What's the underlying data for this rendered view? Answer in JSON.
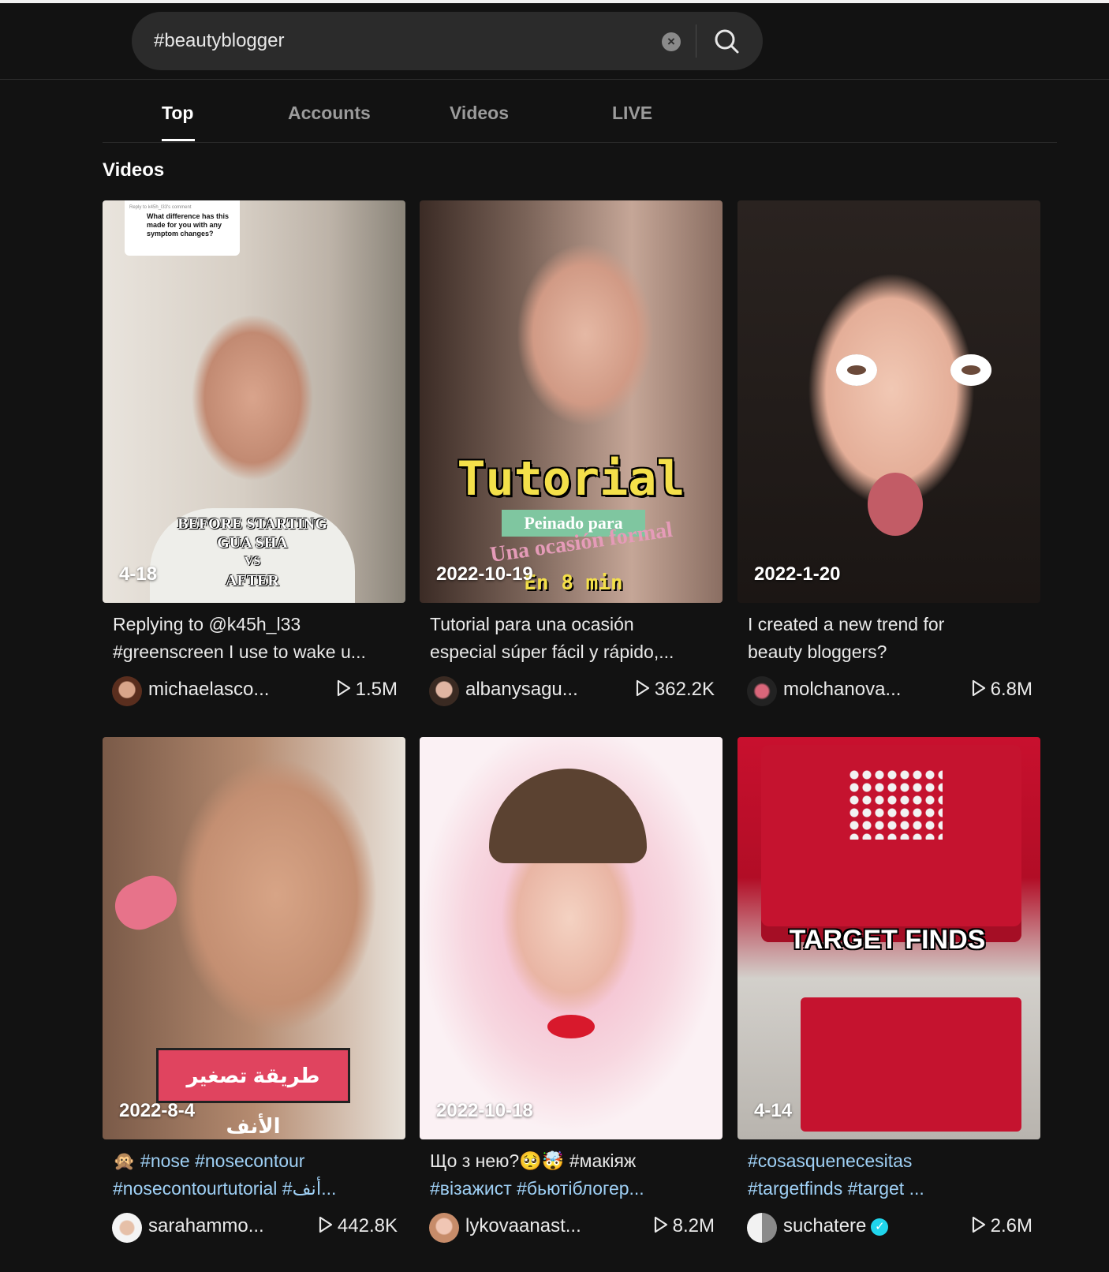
{
  "search": {
    "query": "#beautyblogger",
    "placeholder": "Search",
    "clear_icon": "clear-icon",
    "search_icon": "search-icon"
  },
  "tabs": [
    {
      "label": "Top",
      "active": true
    },
    {
      "label": "Accounts",
      "active": false
    },
    {
      "label": "Videos",
      "active": false
    },
    {
      "label": "LIVE",
      "active": false
    }
  ],
  "section": {
    "title": "Videos"
  },
  "videos": [
    {
      "date": "4-18",
      "caption_lines": [
        "Replying to @k45h_l33",
        "#greenscreen I use to wake u..."
      ],
      "comment_sticker": {
        "header": "Reply to k45h_l33's comment",
        "text": "What difference has this made for you with any symptom changes?"
      },
      "overlay_text": [
        "BEFORE STARTING",
        "GUA SHA",
        "VS",
        "AFTER"
      ],
      "username": "michaelasco...",
      "plays": "1.5M"
    },
    {
      "date": "2022-10-19",
      "caption_lines": [
        "Tutorial para una ocasión",
        "especial súper fácil y rápido,..."
      ],
      "overlay_text": [
        "Tutorial",
        "Peinado para",
        "Una ocasión formal",
        "En 8 min"
      ],
      "username": "albanysagu...",
      "plays": "362.2K"
    },
    {
      "date": "2022-1-20",
      "caption_lines": [
        "I created a new trend for",
        "beauty bloggers?"
      ],
      "username": "molchanova...",
      "plays": "6.8M"
    },
    {
      "date": "2022-8-4",
      "caption_lines": [
        "🙊 #nose #nosecontour",
        "#nosecontourtutorial #أنف..."
      ],
      "overlay_text": [
        "طريقة تصغير الأنف"
      ],
      "username": "sarahammo...",
      "plays": "442.8K"
    },
    {
      "date": "2022-10-18",
      "caption_lines": [
        "Що з нею?🥺🤯 #макіяж",
        "#візажист #бьютіблогер..."
      ],
      "username": "lykovaanast...",
      "plays": "8.2M"
    },
    {
      "date": "4-14",
      "caption_lines": [
        "#cosasquenecesitas",
        "#targetfinds #target ..."
      ],
      "overlay_text": [
        "TARGET FINDS"
      ],
      "username": "suchatere",
      "verified": true,
      "plays": "2.6M"
    }
  ]
}
